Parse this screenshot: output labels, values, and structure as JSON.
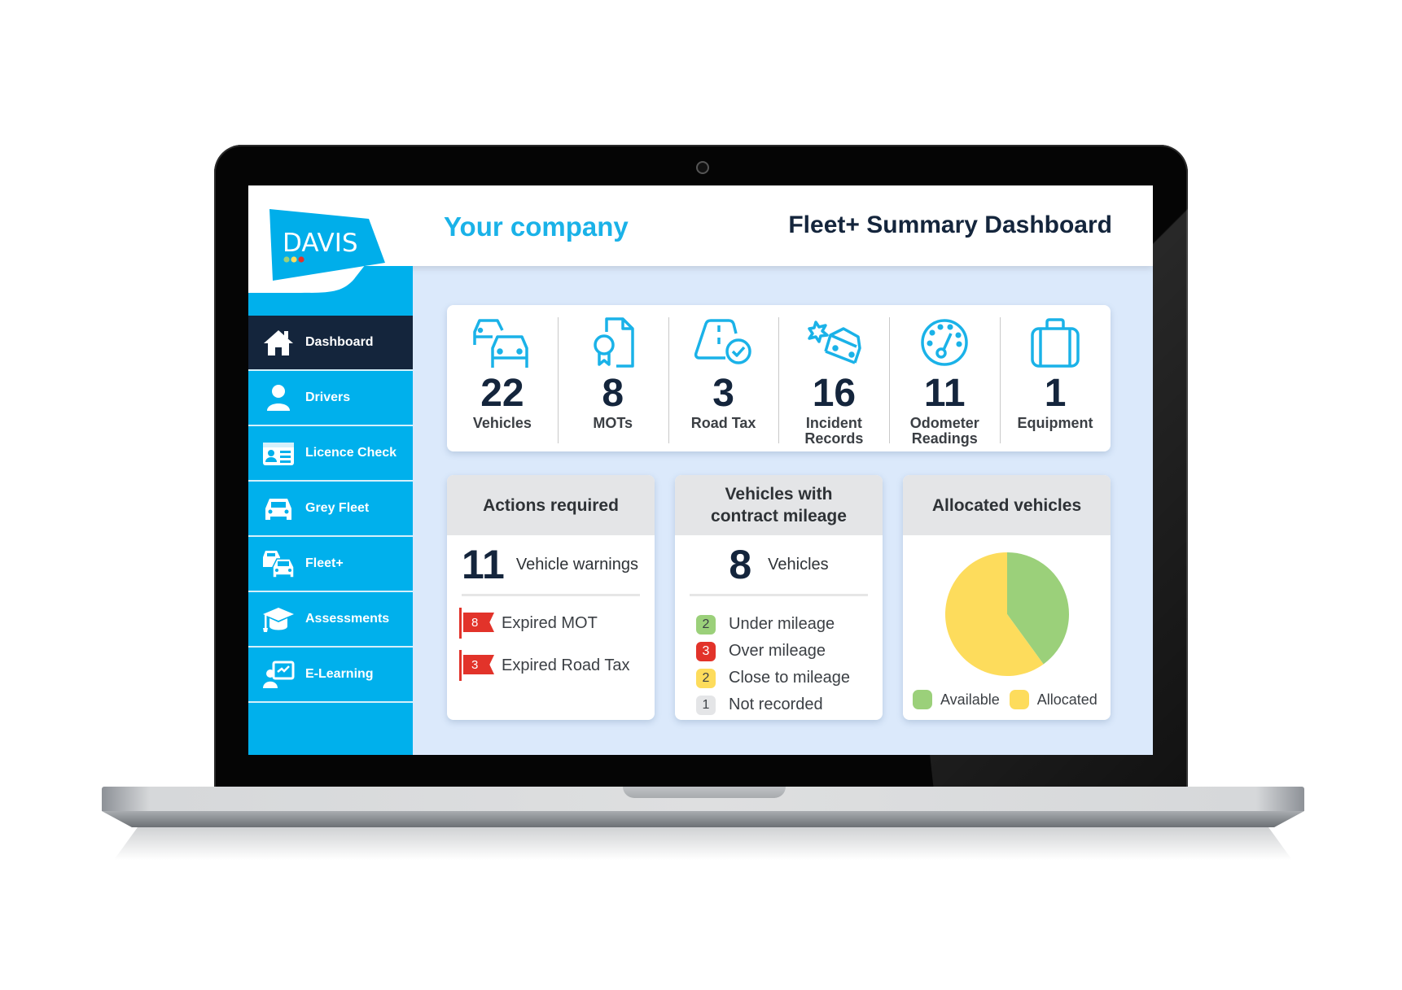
{
  "header": {
    "logo_text": "DAVIS",
    "company": "Your company",
    "title": "Fleet+ Summary Dashboard"
  },
  "sidebar": {
    "items": [
      {
        "label": "Dashboard",
        "icon": "home-icon",
        "active": true
      },
      {
        "label": "Drivers",
        "icon": "user-icon",
        "active": false
      },
      {
        "label": "Licence Check",
        "icon": "id-card-icon",
        "active": false
      },
      {
        "label": "Grey Fleet",
        "icon": "car-icon",
        "active": false
      },
      {
        "label": "Fleet+",
        "icon": "cars-icon",
        "active": false
      },
      {
        "label": "Assessments",
        "icon": "graduation-cap-icon",
        "active": false
      },
      {
        "label": "E-Learning",
        "icon": "presentation-icon",
        "active": false
      }
    ]
  },
  "stats": [
    {
      "value": "22",
      "label": "Vehicles",
      "icon": "cars-icon"
    },
    {
      "value": "8",
      "label": "MOTs",
      "icon": "certificate-icon"
    },
    {
      "value": "3",
      "label": "Road Tax",
      "icon": "road-check-icon"
    },
    {
      "value": "16",
      "label": "Incident Records",
      "icon": "car-crash-icon"
    },
    {
      "value": "11",
      "label": "Odometer Readings",
      "icon": "gauge-icon"
    },
    {
      "value": "1",
      "label": "Equipment",
      "icon": "briefcase-icon"
    }
  ],
  "actions": {
    "title": "Actions required",
    "count": "11",
    "count_label": "Vehicle warnings",
    "items": [
      {
        "count": "8",
        "label": "Expired MOT"
      },
      {
        "count": "3",
        "label": "Expired Road Tax"
      }
    ]
  },
  "mileage": {
    "title": "Vehicles with contract mileage",
    "count": "8",
    "count_label": "Vehicles",
    "items": [
      {
        "count": "2",
        "label": "Under mileage",
        "color": "#9bd07a",
        "text_color": "#3b3f44"
      },
      {
        "count": "3",
        "label": "Over mileage",
        "color": "#e2332a",
        "text_color": "#ffffff"
      },
      {
        "count": "2",
        "label": "Close to mileage",
        "color": "#fddc5c",
        "text_color": "#3b3f44"
      },
      {
        "count": "1",
        "label": "Not recorded",
        "color": "#e4e5e7",
        "text_color": "#3b3f44"
      }
    ]
  },
  "allocated": {
    "title": "Allocated vehicles"
  },
  "chart_data": {
    "type": "pie",
    "title": "Allocated vehicles",
    "categories": [
      "Available",
      "Allocated"
    ],
    "values": [
      40,
      60
    ],
    "colors": [
      "#9bd07a",
      "#fddc5c"
    ],
    "legend": "bottom"
  }
}
